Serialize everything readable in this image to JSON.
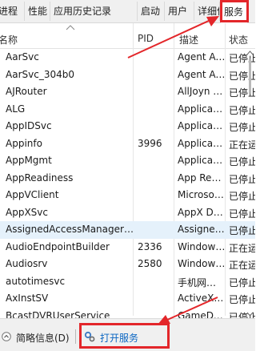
{
  "tabs": [
    {
      "label": "进程",
      "active": false
    },
    {
      "label": "性能",
      "active": false
    },
    {
      "label": "应用历史记录",
      "active": false
    },
    {
      "label": "启动",
      "active": false
    },
    {
      "label": "用户",
      "active": false
    },
    {
      "label": "详细信息",
      "active": false
    },
    {
      "label": "服务",
      "active": true
    }
  ],
  "columns": {
    "name": "名称",
    "pid": "PID",
    "description": "描述",
    "status": "状态"
  },
  "services": [
    {
      "name": "AarSvc",
      "pid": "",
      "description": "Agent Activation Runtime",
      "status": "已停止"
    },
    {
      "name": "AarSvc_304b0",
      "pid": "",
      "description": "Agent Activation Runtime",
      "status": "已停止"
    },
    {
      "name": "AJRouter",
      "pid": "",
      "description": "AllJoyn Router Service",
      "status": "已停止"
    },
    {
      "name": "ALG",
      "pid": "",
      "description": "Application Layer Gateway",
      "status": "已停止"
    },
    {
      "name": "AppIDSvc",
      "pid": "",
      "description": "Application Identity",
      "status": "已停止"
    },
    {
      "name": "Appinfo",
      "pid": "3996",
      "description": "Application Information",
      "status": "正在运行"
    },
    {
      "name": "AppMgmt",
      "pid": "",
      "description": "Application Management",
      "status": "已停止"
    },
    {
      "name": "AppReadiness",
      "pid": "",
      "description": "App Readiness",
      "status": "已停止"
    },
    {
      "name": "AppVClient",
      "pid": "",
      "description": "Microsoft App-V Client",
      "status": "已停止"
    },
    {
      "name": "AppXSvc",
      "pid": "",
      "description": "AppX Deployment Service",
      "status": "已停止"
    },
    {
      "name": "AssignedAccessManagerSvc",
      "pid": "",
      "description": "AssignedAccessManager",
      "status": "已停止"
    },
    {
      "name": "AudioEndpointBuilder",
      "pid": "2336",
      "description": "Windows Audio Endpoint Builder",
      "status": "正在运行"
    },
    {
      "name": "Audiosrv",
      "pid": "2580",
      "description": "Windows Audio",
      "status": "正在运行"
    },
    {
      "name": "autotimesvc",
      "pid": "",
      "description": "手机网络时间",
      "status": "已停止"
    },
    {
      "name": "AxInstSV",
      "pid": "",
      "description": "ActiveX Installer",
      "status": "已停止"
    },
    {
      "name": "BcastDVRUserService",
      "pid": "",
      "description": "GameDVR and Broadcast",
      "status": "已停止"
    }
  ],
  "selected_index": 10,
  "footer": {
    "less_details": "简略信息(D)",
    "open_services": "打开服务"
  },
  "colors": {
    "highlight": "#e3262a",
    "link": "#0b66c2",
    "selection": "#e5f1fb"
  }
}
